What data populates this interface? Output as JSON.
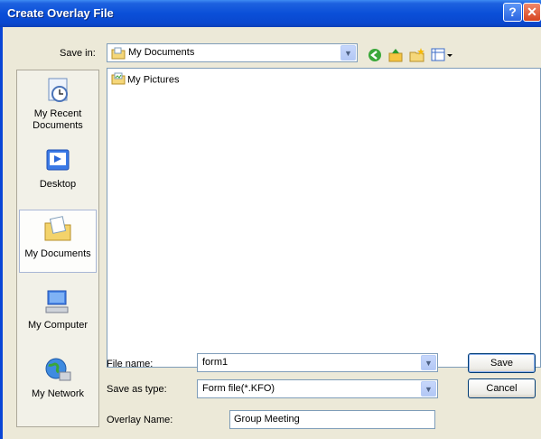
{
  "window": {
    "title": "Create Overlay File"
  },
  "save_in": {
    "label": "Save in:",
    "value": "My Documents"
  },
  "places": [
    {
      "label": "My Recent Documents",
      "icon": "recent-documents-icon"
    },
    {
      "label": "Desktop",
      "icon": "desktop-icon"
    },
    {
      "label": "My Documents",
      "icon": "my-documents-icon"
    },
    {
      "label": "My Computer",
      "icon": "my-computer-icon"
    },
    {
      "label": "My Network",
      "icon": "my-network-icon"
    }
  ],
  "files": [
    {
      "name": "My Pictures",
      "icon": "folder-pictures-icon"
    }
  ],
  "file_name": {
    "label": "File name:",
    "value": "form1"
  },
  "save_as_type": {
    "label": "Save as type:",
    "value": "Form file(*.KFO)"
  },
  "overlay_name": {
    "label": "Overlay Name:",
    "value": "Group Meeting"
  },
  "buttons": {
    "save": "Save",
    "cancel": "Cancel"
  },
  "colors": {
    "titlebar": "#0a4fd8",
    "dialog_bg": "#ece9d8",
    "close_button": "#d6451f"
  }
}
